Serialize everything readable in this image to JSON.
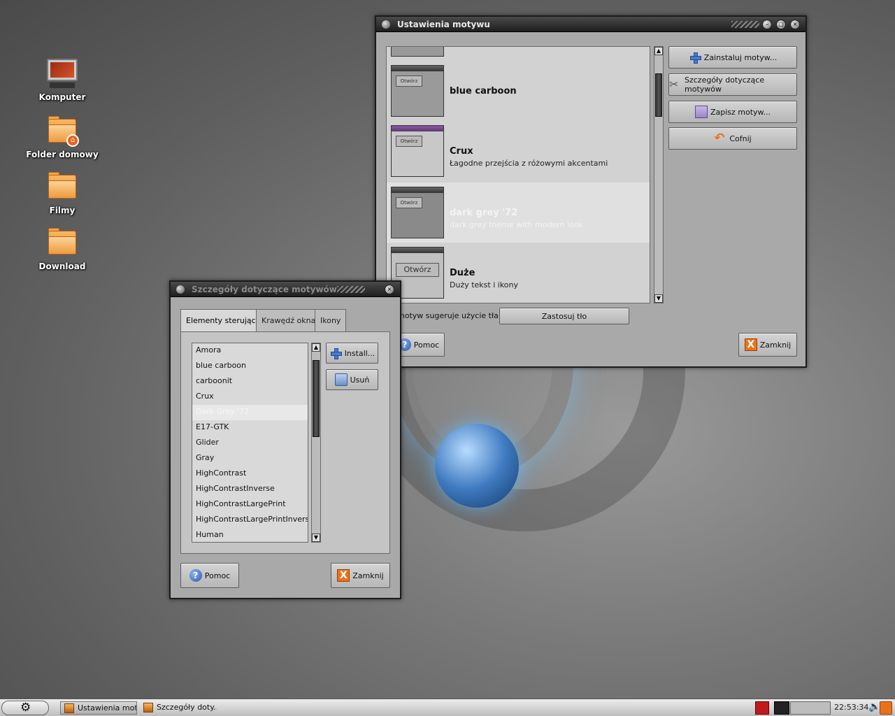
{
  "desktop": {
    "icons": [
      {
        "label": "Komputer",
        "icon": "computer-icon"
      },
      {
        "label": "Folder domowy",
        "icon": "home-folder-icon"
      },
      {
        "label": "Filmy",
        "icon": "folder-icon"
      },
      {
        "label": "Download",
        "icon": "folder-icon"
      }
    ]
  },
  "main_window": {
    "title": "Ustawienia motywu",
    "themes": [
      {
        "name": "blue carboon",
        "desc": "",
        "thumb_label": "Otwórz"
      },
      {
        "name": "Crux",
        "desc": "Łagodne przejścia z różowymi akcentami",
        "thumb_label": "Otwórz"
      },
      {
        "name": "dark grey '72",
        "desc": "dark grey theme with modern look.",
        "thumb_label": "Otwórz",
        "selected": true
      },
      {
        "name": "Duże",
        "desc": "Duży tekst i ikony",
        "thumb_label": "Otwórz"
      }
    ],
    "buttons": {
      "install": "Zainstaluj motyw...",
      "details": "Szczegóły dotyczące motywów",
      "save": "Zapisz motyw...",
      "revert": "Cofnij",
      "apply_bg": "Zastosuj tło",
      "help": "Pomoc",
      "close": "Zamknij"
    },
    "bg_hint": "motyw sugeruje użycie tła:"
  },
  "details_window": {
    "title": "Szczegóły dotyczące motywów",
    "tabs": [
      "Elementy sterujące",
      "Krawędź okna",
      "Ikony"
    ],
    "items": [
      "Amora",
      "blue carboon",
      "carboonit",
      "Crux",
      "Dark Grey '72",
      "E17-GTK",
      "Glider",
      "Gray",
      "HighContrast",
      "HighContrastInverse",
      "HighContrastLargePrint",
      "HighContrastLargePrintInverse",
      "Human"
    ],
    "selected_item": "Dark Grey '72",
    "buttons": {
      "install": "Install...",
      "remove": "Usuń",
      "help": "Pomoc",
      "close": "Zamknij"
    }
  },
  "taskbar": {
    "tasks": [
      "Ustawienia mot...",
      "Szczegóły doty..."
    ],
    "clock": "22:53:34"
  },
  "colors": {
    "accent": "#e8731c",
    "titlebar": "#1e1e1e",
    "window_bg": "#a9a9a9"
  }
}
